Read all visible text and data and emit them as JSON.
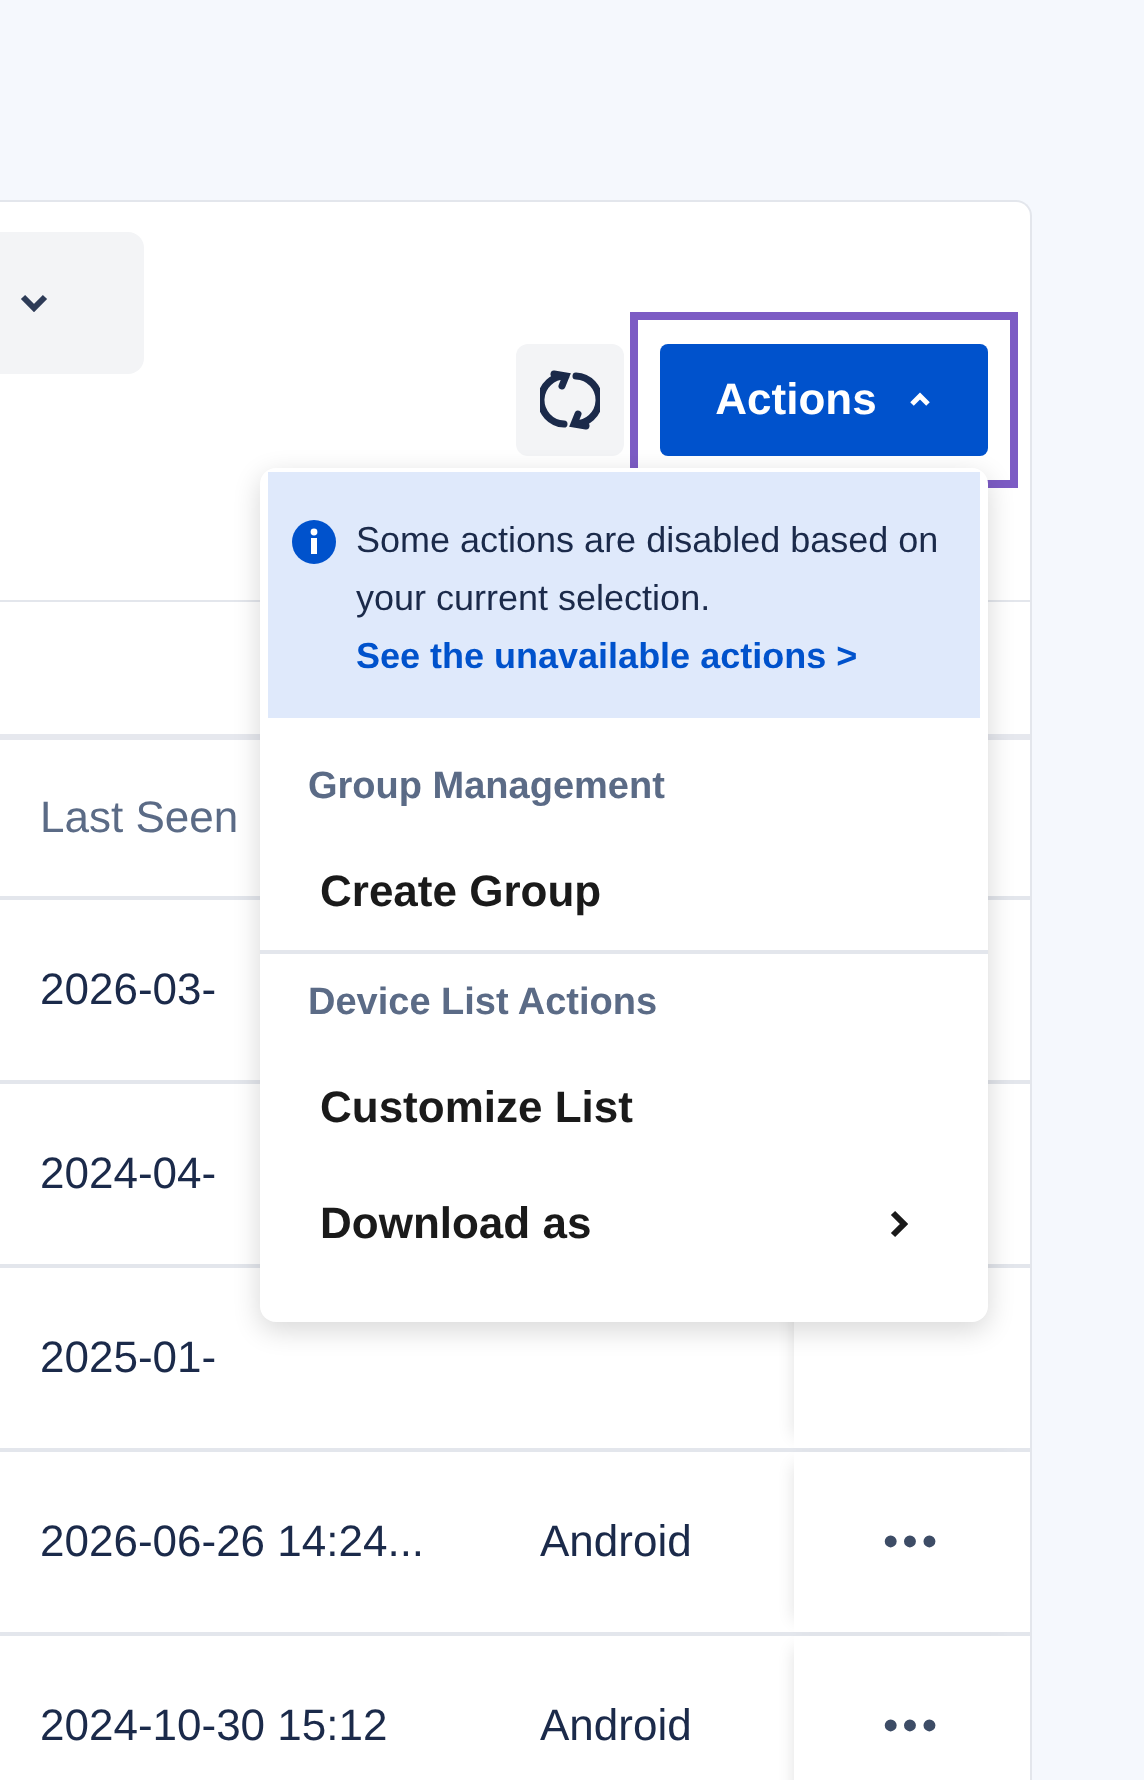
{
  "toolbar": {
    "actions_button": {
      "label": "Actions",
      "expanded": true,
      "focused": true
    }
  },
  "table": {
    "column_1": "Last Seen",
    "rows": [
      {
        "last_seen": "2026-03-"
      },
      {
        "last_seen": "2024-04-"
      },
      {
        "last_seen": "2025-01-"
      },
      {
        "last_seen": "2026-06-26 14:24...",
        "os": "Android",
        "more": "•••"
      },
      {
        "last_seen": "2024-10-30 15:12",
        "os": "Android",
        "more": "•••"
      }
    ]
  },
  "menu": {
    "notice": {
      "text": "Some actions are disabled based on your current selection.",
      "link": "See the unavailable actions >"
    },
    "sections": [
      {
        "title": "Group Management",
        "items": [
          {
            "label": "Create Group",
            "submenu": false
          }
        ]
      },
      {
        "title": "Device List Actions",
        "items": [
          {
            "label": "Customize List",
            "submenu": false
          },
          {
            "label": "Download as",
            "submenu": true
          }
        ]
      }
    ]
  }
}
